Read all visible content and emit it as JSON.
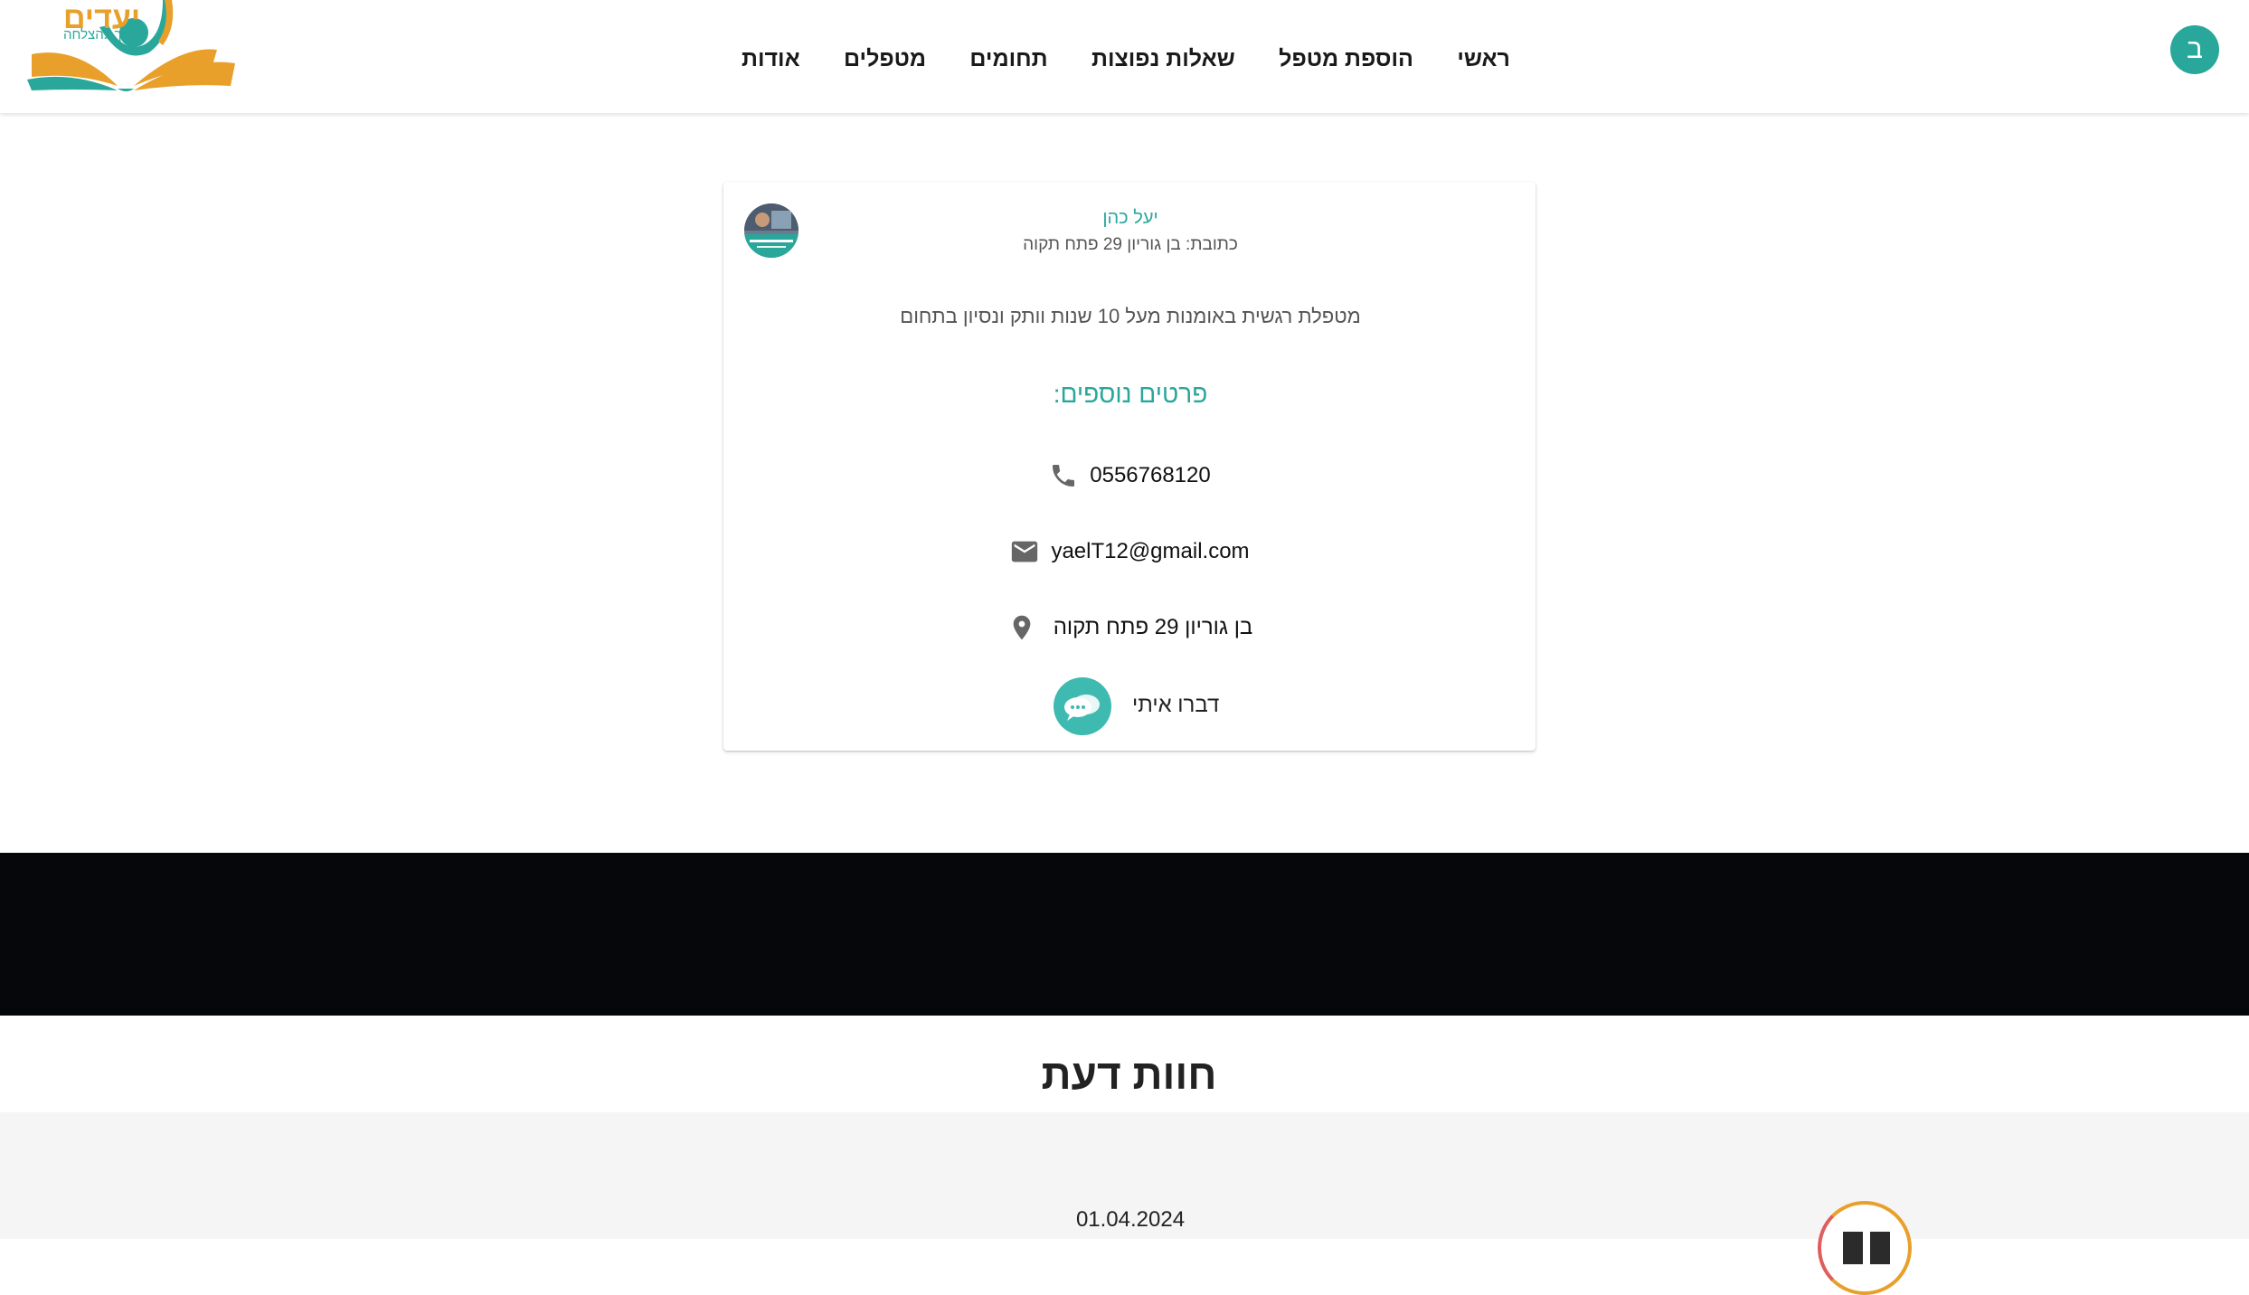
{
  "header": {
    "logo": {
      "title": "יעדים",
      "subtitle": "הדרך להצלחה"
    },
    "nav": [
      {
        "label": "ראשי"
      },
      {
        "label": "הוספת מטפל"
      },
      {
        "label": "שאלות נפוצות"
      },
      {
        "label": "תחומים"
      },
      {
        "label": "מטפלים"
      },
      {
        "label": "אודות"
      }
    ],
    "user_initial": "ב"
  },
  "therapist": {
    "name": "יעל כהן",
    "address_line": "כתובת: בן גוריון 29 פתח תקוה",
    "description": "מטפלת רגשית באומנות מעל 10 שנות וותק ונסיון בתחום",
    "more_details_title": "פרטים נוספים:",
    "phone": "0556768120",
    "email": "yaelT12@gmail.com",
    "location": "בן גוריון 29 פתח תקוה",
    "chat_label": "דברו איתי"
  },
  "opinions": {
    "title": "חוות דעת",
    "items": [
      {
        "date": "01.04.2024"
      }
    ]
  },
  "colors": {
    "accent": "#2aa79b",
    "logo_orange": "#e8a02b",
    "band": "#05070b",
    "opinions_bg": "#f5f5f5"
  },
  "icons": {
    "phone": "phone-icon",
    "email": "email-icon",
    "location": "location-pin-icon",
    "chat": "chat-bubbles-icon",
    "quote": "quote-icon"
  }
}
